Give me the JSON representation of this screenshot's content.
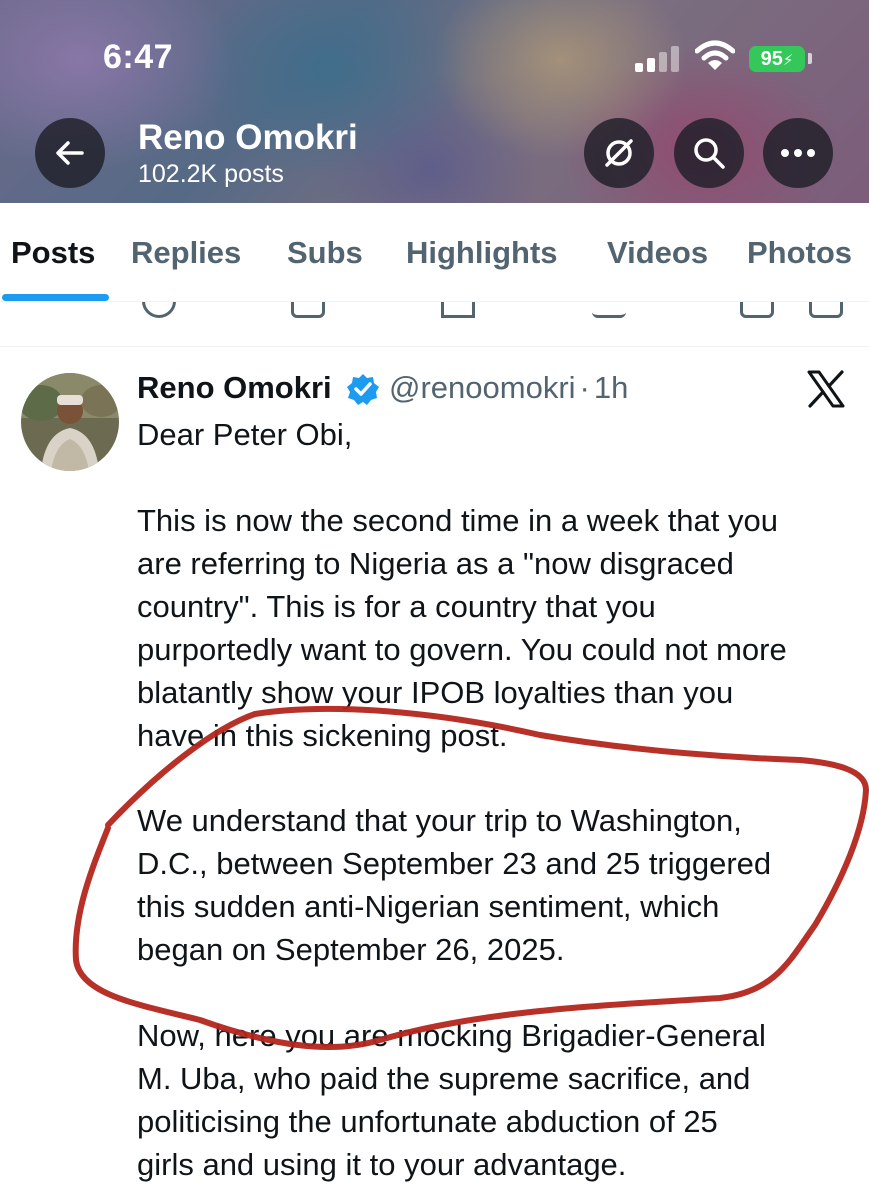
{
  "status_bar": {
    "time": "6:47",
    "battery": "95"
  },
  "header": {
    "name": "Reno Omokri",
    "posts_count": "102.2K posts"
  },
  "tabs": [
    {
      "label": "Posts",
      "active": true
    },
    {
      "label": "Replies",
      "active": false
    },
    {
      "label": "Subs",
      "active": false
    },
    {
      "label": "Highlights",
      "active": false
    },
    {
      "label": "Videos",
      "active": false
    },
    {
      "label": "Photos",
      "active": false
    }
  ],
  "tweet": {
    "display_name": "Reno Omokri",
    "handle": "@renoomokri",
    "separator": "·",
    "time_ago": "1h",
    "lines": [
      "Dear Peter Obi,",
      "This is now the second time in a week that you",
      "are referring to Nigeria as a \"now disgraced",
      "country\". This is for a country that you",
      "purportedly want to govern. You could not more",
      "blatantly show your IPOB loyalties than you",
      "have in this sickening post.",
      "We understand that your trip to Washington,",
      "D.C., between September 23 and 25 triggered",
      "this sudden anti-Nigerian sentiment, which",
      "began on September 26, 2025.",
      "Now, here you are mocking Brigadier-General",
      "M. Uba, who paid the supreme sacrifice, and",
      "politicising the unfortunate abduction of 25",
      "girls and using it to your advantage."
    ]
  },
  "colors": {
    "accent": "#1d9bf0",
    "verified": "#1d9bf0",
    "annotation": "#b3261e",
    "battery": "#34c759"
  },
  "icons": [
    "back-arrow-icon",
    "grok-slash-icon",
    "search-icon",
    "more-icon",
    "verified-badge-icon",
    "x-logo-icon"
  ]
}
